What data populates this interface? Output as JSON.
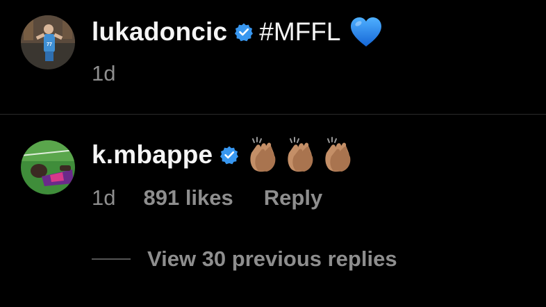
{
  "comments": [
    {
      "username": "lukadoncic",
      "verified": true,
      "text": "#MFFL",
      "emoji": "blue-heart",
      "time": "1d"
    },
    {
      "username": "k.mbappe",
      "verified": true,
      "text": "",
      "emoji": "clapping-hands-x3",
      "time": "1d",
      "likes": "891 likes",
      "reply_label": "Reply"
    }
  ],
  "view_replies": {
    "label": "View 30 previous replies"
  },
  "colors": {
    "background": "#000000",
    "primary_text": "#f5f5f5",
    "secondary_text": "#8e8e8e",
    "verified_badge": "#3897f0",
    "heart": "#1e90ff"
  }
}
